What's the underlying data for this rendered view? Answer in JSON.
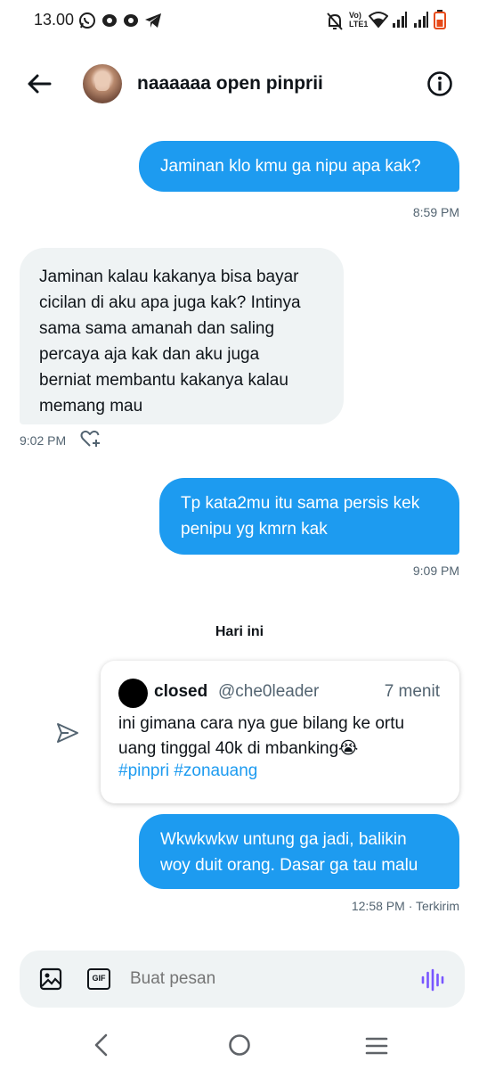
{
  "status_bar": {
    "time": "13.00",
    "network_label": "Vo) LTE1"
  },
  "header": {
    "contact_name": "naaaaaa open pinprii"
  },
  "messages": [
    {
      "direction": "out",
      "text": "Jaminan klo kmu ga nipu apa kak?",
      "time": "8:59 PM"
    },
    {
      "direction": "in",
      "lines": [
        "Jaminan kalau kakanya bisa bayar",
        "cicilan di aku apa juga kak? Intinya",
        "sama sama amanah dan saling",
        "percaya aja kak dan aku juga",
        "berniat membantu kakanya kalau",
        "memang mau"
      ],
      "time": "9:02 PM"
    },
    {
      "direction": "out",
      "lines": [
        "Tp kata2mu itu sama persis kek",
        "penipu yg kmrn kak"
      ],
      "time": "9:09 PM"
    }
  ],
  "day_separator": "Hari ini",
  "quoted_post": {
    "name": "closed",
    "handle": "@che0leader",
    "ago": "7 menit",
    "lines": [
      "ini gimana cara nya gue bilang ke ortu",
      "uang tinggal 40k di mbanking😭"
    ],
    "hashtags": "#pinpri #zonauang"
  },
  "reply": {
    "lines": [
      "Wkwkwkw untung ga jadi, balikin",
      "woy duit orang. Dasar ga tau malu"
    ],
    "time": "12:58 PM",
    "status": "Terkirim"
  },
  "composer": {
    "placeholder": "Buat pesan",
    "gif_label": "GIF"
  },
  "colors": {
    "accent": "#1d9bf0",
    "incoming_bubble": "#eff3f4",
    "muted_text": "#536471",
    "voice_icon": "#7856ff"
  },
  "icons": [
    "whatsapp-icon",
    "app-icon",
    "telegram-icon",
    "bell-off-icon",
    "wifi-icon",
    "signal-icon",
    "battery-icon",
    "back-arrow-icon",
    "info-icon",
    "heart-plus-icon",
    "send-icon",
    "image-icon",
    "gif-icon",
    "voice-icon",
    "nav-back-icon",
    "nav-home-icon",
    "nav-menu-icon"
  ]
}
